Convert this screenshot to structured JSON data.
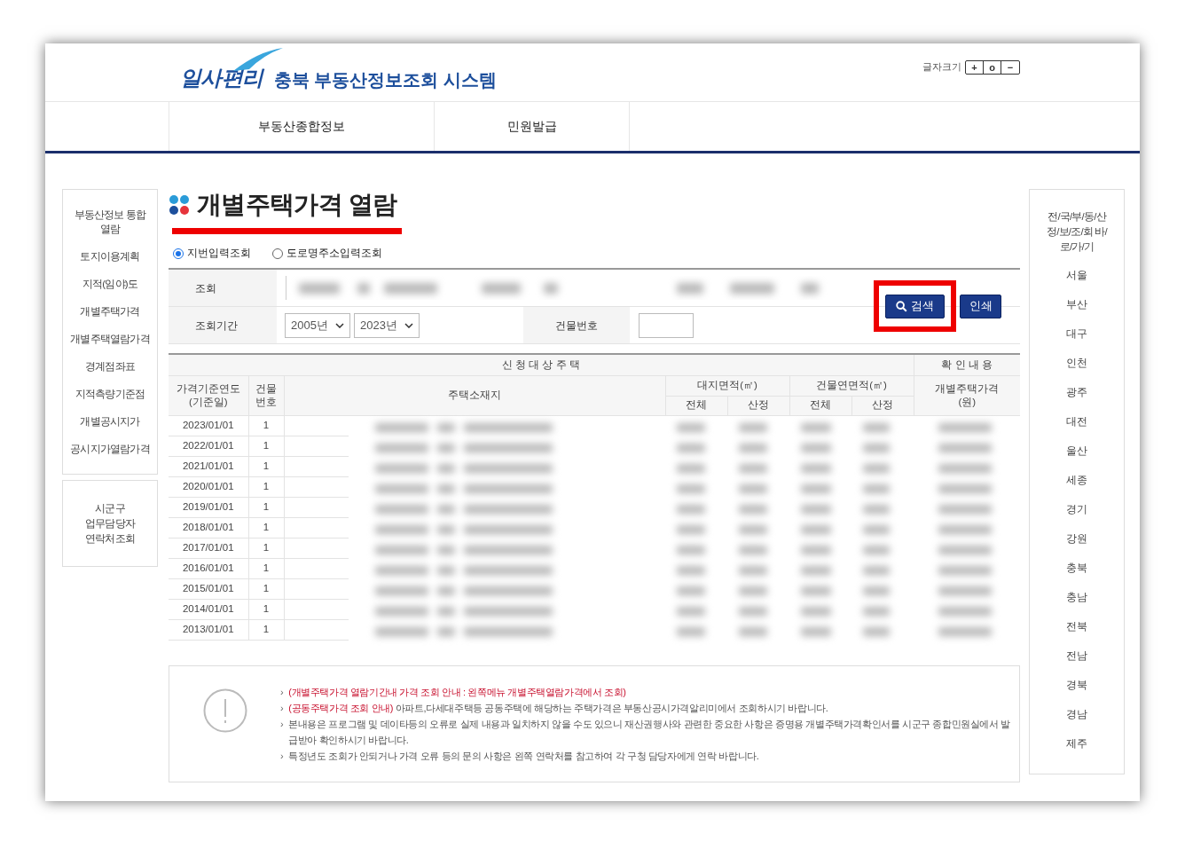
{
  "header": {
    "logo": "일사편리",
    "site_title": "충북 부동산정보조회 시스템",
    "font_size": {
      "label": "글자크기",
      "buttons": [
        "+",
        "o",
        "−"
      ]
    }
  },
  "nav": [
    {
      "label": "부동산종합정보",
      "selected": false
    },
    {
      "label": "민원발급",
      "selected": false
    }
  ],
  "left_menu": [
    "부동산정보 통합 열람",
    "토지이용계획",
    "지적(임야)도",
    "개별주택가격",
    "개별주택열람가격",
    "경계점좌표",
    "지적측량기준점",
    "개별공시지가",
    "공시지가열람가격"
  ],
  "contact_box": "시군구 업무담당자 연락처조회",
  "page_title": {
    "text": "개별주택가격 열람",
    "underlined": true
  },
  "search_modes": [
    {
      "label": "지번입력조회",
      "selected": true
    },
    {
      "label": "도로명주소입력조회",
      "selected": false
    }
  ],
  "search_form": {
    "query_label": "조회",
    "period_label": "조회기간",
    "period_from": "2005년",
    "period_to": "2023년",
    "building_label": "건물번호",
    "search_button": {
      "label": "검색",
      "highlighted": true
    },
    "print_button": "인쇄"
  },
  "results": {
    "group_headers": [
      "신 청 대 상 주 택",
      "확 인 내 용"
    ],
    "columns": [
      "가격기준연도 (기준일)",
      "건물 번호",
      "주택소재지",
      "대지면적(㎡)",
      "건물연면적(㎡)",
      "개별주택가격 (원)"
    ],
    "sub_columns": [
      "전체",
      "산정",
      "전체",
      "산정"
    ],
    "rows": [
      {
        "date": "2023/01/01",
        "building_no": "1"
      },
      {
        "date": "2022/01/01",
        "building_no": "1"
      },
      {
        "date": "2021/01/01",
        "building_no": "1"
      },
      {
        "date": "2020/01/01",
        "building_no": "1"
      },
      {
        "date": "2019/01/01",
        "building_no": "1"
      },
      {
        "date": "2018/01/01",
        "building_no": "1"
      },
      {
        "date": "2017/01/01",
        "building_no": "1"
      },
      {
        "date": "2016/01/01",
        "building_no": "1"
      },
      {
        "date": "2015/01/01",
        "building_no": "1"
      },
      {
        "date": "2014/01/01",
        "building_no": "1"
      },
      {
        "date": "2013/01/01",
        "building_no": "1"
      }
    ]
  },
  "notices": [
    {
      "marker": "›",
      "highlight": "(개별주택가격 열람기간내 가격 조회 안내 : 왼쪽메뉴 개별주택열람가격에서 조회)"
    },
    {
      "marker": "›",
      "highlight": "(공동주택가격 조회 안내)",
      "text": "아파트,다세대주택등 공동주택에 해당하는 주택가격은 부동산공시가격알리미에서 조회하시기 바랍니다."
    },
    {
      "marker": "›",
      "text": "본내용은 프로그램 및 데이타등의 오류로 실제 내용과 일치하지 않을 수도 있으니 재산권행사와 관련한 중요한 사항은 증명용 개별주택가격확인서를 시군구 종합민원실에서 발급받아 확인하시기 바랍니다."
    },
    {
      "marker": "›",
      "text": "특정년도 조회가 안되거나 가격 오류 등의 문의 사항은 왼쪽 연락처를 참고하여 각 구청 담당자에게 연락 바랍니다."
    }
  ],
  "region_menu": {
    "title": "전/국/부/동/산 정/보/조/회 바/로/가/기",
    "items": [
      "서울",
      "부산",
      "대구",
      "인천",
      "광주",
      "대전",
      "울산",
      "세종",
      "경기",
      "강원",
      "충북",
      "충남",
      "전북",
      "전남",
      "경북",
      "경남",
      "제주"
    ]
  }
}
